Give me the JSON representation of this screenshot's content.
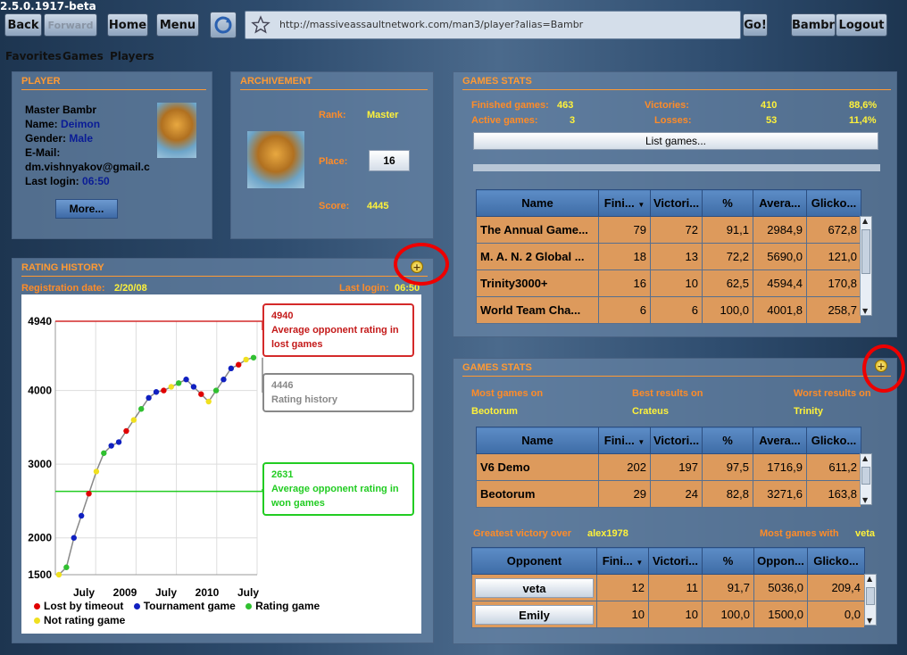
{
  "app": {
    "version": "2.5.0.1917-beta"
  },
  "toolbar": {
    "back": "Back",
    "forward": "Forward",
    "home": "Home",
    "menu": "Menu",
    "url": "http://massiveassaultnetwork.com/man3/player?alias=Bambr",
    "go": "Go!",
    "user": "Bambr",
    "logout": "Logout"
  },
  "nav": {
    "favorites": "Favorites",
    "games": "Games",
    "players": "Players"
  },
  "player": {
    "title": "PLAYER",
    "name_line": "Master Bambr",
    "name_label": "Name:",
    "name": "Deimon",
    "gender_label": "Gender:",
    "gender": "Male",
    "email_label": "E-Mail:",
    "email": "dm.vishnyakov@gmail.c",
    "login_label": "Last login:",
    "login": "06:50",
    "more": "More..."
  },
  "achievement": {
    "title": "ARCHIVEMENT",
    "rank_label": "Rank:",
    "rank": "Master",
    "place_label": "Place:",
    "place": "16",
    "score_label": "Score:",
    "score": "4445"
  },
  "stats1": {
    "title": "GAMES STATS",
    "finished_label": "Finished games:",
    "finished": "463",
    "active_label": "Active games:",
    "active": "3",
    "victories_label": "Victories:",
    "victories": "410",
    "victories_pct": "88,6%",
    "losses_label": "Losses:",
    "losses": "53",
    "losses_pct": "11,4%",
    "list_btn": "List games...",
    "headers": [
      "Name",
      "Fini...",
      "Victori...",
      "%",
      "Avera...",
      "Glicko..."
    ],
    "rows": [
      [
        "The Annual Game...",
        "79",
        "72",
        "91,1",
        "2984,9",
        "672,8"
      ],
      [
        "M. A. N. 2 Global ...",
        "18",
        "13",
        "72,2",
        "5690,0",
        "121,0"
      ],
      [
        "Trinity3000+",
        "16",
        "10",
        "62,5",
        "4594,4",
        "170,8"
      ],
      [
        "World Team Cha...",
        "6",
        "6",
        "100,0",
        "4001,8",
        "258,7"
      ]
    ]
  },
  "stats2": {
    "title": "GAMES STATS",
    "most_label": "Most games on",
    "most": "Beotorum",
    "best_label": "Best results on",
    "best": "Crateus",
    "worst_label": "Worst results on",
    "worst": "Trinity",
    "headers": [
      "Name",
      "Fini...",
      "Victori...",
      "%",
      "Avera...",
      "Glicko..."
    ],
    "rows": [
      [
        "V6 Demo",
        "202",
        "197",
        "97,5",
        "1716,9",
        "611,2"
      ],
      [
        "Beotorum",
        "29",
        "24",
        "82,8",
        "3271,6",
        "163,8"
      ]
    ],
    "greatest_label": "Greatest victory over",
    "greatest": "alex1978",
    "mostwith_label": "Most games with",
    "mostwith": "veta",
    "opp_headers": [
      "Opponent",
      "Fini...",
      "Victori...",
      "%",
      "Oppon...",
      "Glicko..."
    ],
    "opp_rows": [
      [
        "veta",
        "12",
        "11",
        "91,7",
        "5036,0",
        "209,4"
      ],
      [
        "Emily",
        "10",
        "10",
        "100,0",
        "1500,0",
        "0,0"
      ]
    ]
  },
  "rating": {
    "title": "RATING HISTORY",
    "reg_label": "Registration date:",
    "reg": "2/20/08",
    "login_label": "Last login:",
    "login": "06:50",
    "legend": [
      "Lost by timeout",
      "Tournament game",
      "Rating game",
      "Not rating game"
    ]
  },
  "chart_data": {
    "type": "scatter",
    "title": "",
    "xlabel": "",
    "ylabel": "",
    "x_ticks": [
      "July",
      "2009",
      "July",
      "2010",
      "July"
    ],
    "y_ticks": [
      1500,
      2000,
      3000,
      4000,
      4940
    ],
    "ylim": [
      1500,
      4940
    ],
    "series": [
      {
        "name": "Rating history",
        "values": [
          1500,
          1600,
          2000,
          2300,
          2600,
          2900,
          3150,
          3250,
          3300,
          3450,
          3600,
          3750,
          3900,
          3980,
          4000,
          4050,
          4100,
          4150,
          4050,
          3950,
          3850,
          4000,
          4150,
          4300,
          4350,
          4420,
          4446
        ]
      }
    ],
    "lines": [
      {
        "value": 4940,
        "label": "4940",
        "desc": "Average opponent rating in lost games",
        "color": "#d42a2a"
      },
      {
        "value": 4446,
        "label": "4446",
        "desc": "Rating history",
        "color": "#888888"
      },
      {
        "value": 2631,
        "label": "2631",
        "desc": "Average opponent rating in won games",
        "color": "#22cc22"
      }
    ],
    "colors": {
      "lost": "#e00000",
      "tournament": "#1020c0",
      "rating": "#30c030",
      "notrating": "#f0e020"
    },
    "grid": true
  }
}
